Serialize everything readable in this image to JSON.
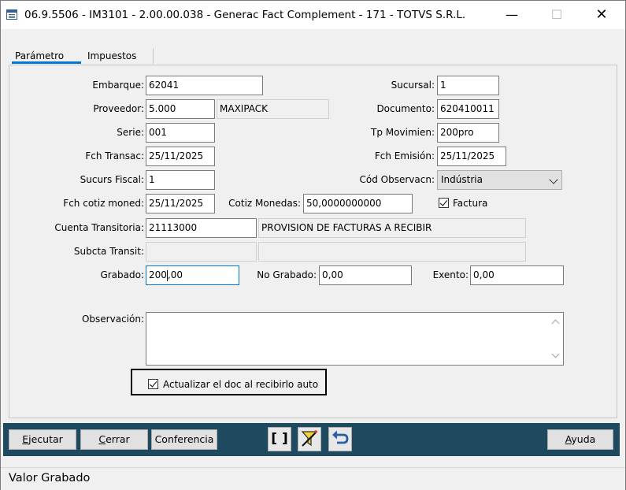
{
  "window": {
    "title": "06.9.5506 - IM3101 - 2.00.00.038 - Generac Fact Complement - 171 - TOTVS S.R.L.",
    "minimize": "—",
    "maximize": "☐",
    "close": "✕"
  },
  "tabs": [
    "Parámetro",
    "Impuestos"
  ],
  "form": {
    "embarque": {
      "label": "Embarque:",
      "value": "62041"
    },
    "sucursal": {
      "label": "Sucursal:",
      "value": "1"
    },
    "proveedor": {
      "label": "Proveedor:",
      "value": "5.000",
      "name": "MAXIPACK"
    },
    "documento": {
      "label": "Documento:",
      "value": "620410011"
    },
    "serie": {
      "label": "Serie:",
      "value": "001"
    },
    "tp_movimien": {
      "label": "Tp Movimien:",
      "value": "200pro"
    },
    "fch_transac": {
      "label": "Fch Transac:",
      "value": "25/11/2025"
    },
    "fch_emision": {
      "label": "Fch Emisión:",
      "value": "25/11/2025"
    },
    "sucurs_fiscal": {
      "label": "Sucurs Fiscal:",
      "value": "1"
    },
    "cod_observacn": {
      "label": "Cód Observacn:",
      "value": "Indústria"
    },
    "fch_cotiz_moned": {
      "label": "Fch cotiz moned:",
      "value": "25/11/2025"
    },
    "cotiz_monedas": {
      "label": "Cotiz Monedas:",
      "value": "50,0000000000"
    },
    "factura": {
      "label": "Factura",
      "checked": true
    },
    "cuenta_transitoria": {
      "label": "Cuenta Transitoria:",
      "value": "21113000",
      "description": "PROVISION DE FACTURAS A  RECIBIR"
    },
    "subcta_transit": {
      "label": "Subcta Transit:",
      "value": "",
      "description": ""
    },
    "grabado": {
      "label": "Grabado:",
      "value_before_caret": "200",
      "value_after_caret": ",00"
    },
    "no_grabado": {
      "label": "No Grabado:",
      "value": "0,00"
    },
    "exento": {
      "label": "Exento:",
      "value": "0,00"
    },
    "observacion": {
      "label": "Observación:",
      "value": ""
    },
    "actualizar": {
      "label": "Actualizar el doc al recibirlo auto",
      "checked": true
    }
  },
  "buttons": {
    "ejecutar": {
      "underline": "E",
      "rest": "jecutar"
    },
    "cerrar": {
      "underline": "C",
      "rest": "errar"
    },
    "conferencia": {
      "label": "Conferencia"
    },
    "brackets": {
      "label": "[ ]"
    },
    "ayuda": {
      "underline": "A",
      "rest": "yuda"
    }
  },
  "icons": [
    "app-icon",
    "filter-wand-icon",
    "undo-arrow-icon",
    "scroll-up-icon",
    "scroll-down-icon",
    "dropdown-arrow-icon"
  ],
  "colors": {
    "toolbar": "#1d4a5e",
    "tab_accent": "#0078d7",
    "toolbar_icon": "#2a5fa8"
  },
  "status": {
    "text": "Valor Grabado"
  }
}
